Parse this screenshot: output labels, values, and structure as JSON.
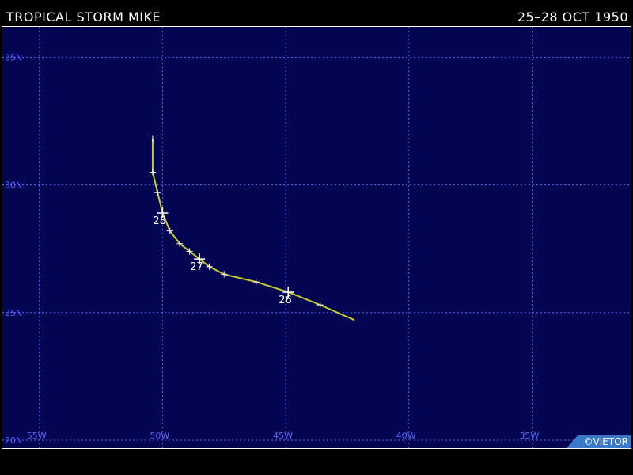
{
  "header": {
    "storm_title": "TROPICAL STORM MIKE",
    "date_range": "25–28 OCT 1950"
  },
  "map": {
    "lat_labels": [
      "35N",
      "30N",
      "25N",
      "20N"
    ],
    "lon_labels": [
      "55W",
      "50W",
      "45W",
      "40W",
      "35W"
    ],
    "lat_range": [
      20,
      36.5
    ],
    "lon_range": [
      -56.5,
      -31.0
    ],
    "grid_lats": [
      35,
      30,
      25,
      20
    ],
    "grid_lons": [
      -55,
      -50,
      -45,
      -40,
      -35
    ],
    "colors": {
      "ocean": "#020552",
      "grid": "#5a66ff",
      "track": "#c8c830",
      "marker": "#ffffff",
      "label": "#ffffff"
    }
  },
  "track": {
    "points": [
      {
        "lat": 24.7,
        "lon": -42.2
      },
      {
        "lat": 25.3,
        "lon": -43.6
      },
      {
        "lat": 25.8,
        "lon": -44.9
      },
      {
        "lat": 26.2,
        "lon": -46.2
      },
      {
        "lat": 26.5,
        "lon": -47.5
      },
      {
        "lat": 26.8,
        "lon": -48.1
      },
      {
        "lat": 27.1,
        "lon": -48.5
      },
      {
        "lat": 27.4,
        "lon": -48.9
      },
      {
        "lat": 27.7,
        "lon": -49.3
      },
      {
        "lat": 28.2,
        "lon": -49.7
      },
      {
        "lat": 28.9,
        "lon": -50.0
      },
      {
        "lat": 29.7,
        "lon": -50.2
      },
      {
        "lat": 30.5,
        "lon": -50.4
      },
      {
        "lat": 31.8,
        "lon": -50.4
      }
    ],
    "day_markers": [
      {
        "day": "26",
        "lat": 25.8,
        "lon": -44.9
      },
      {
        "day": "27",
        "lat": 27.1,
        "lon": -48.5
      },
      {
        "day": "28",
        "lat": 28.9,
        "lon": -50.0
      }
    ]
  },
  "credit": "©VIETOR"
}
